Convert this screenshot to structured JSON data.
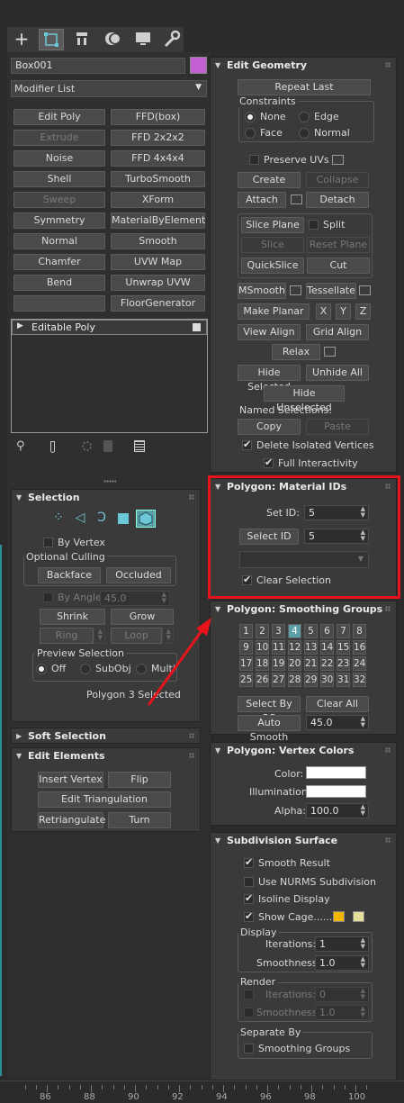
{
  "command_tabs": [
    "create-icon",
    "modify-icon",
    "hierarchy-icon",
    "motion-icon",
    "display-icon",
    "utilities-icon"
  ],
  "object": {
    "name": "Box001",
    "color": "#c35fd2"
  },
  "modifier_list": "Modifier List",
  "modifier_buttons": [
    [
      "Edit Poly",
      "FFD(box)"
    ],
    [
      "Extrude",
      "FFD 2x2x2"
    ],
    [
      "Noise",
      "FFD 4x4x4"
    ],
    [
      "Shell",
      "TurboSmooth"
    ],
    [
      "Sweep",
      "XForm"
    ],
    [
      "Symmetry",
      "MaterialByElement"
    ],
    [
      "Normal",
      "Smooth"
    ],
    [
      "Chamfer",
      "UVW Map"
    ],
    [
      "Bend",
      "Unwrap UVW"
    ],
    [
      "",
      "FloorGenerator"
    ]
  ],
  "stack": {
    "item": "Editable Poly"
  },
  "selection": {
    "title": "Selection",
    "by_vertex": "By Vertex",
    "optional_culling": "Optional Culling",
    "backface": "Backface",
    "occluded": "Occluded",
    "by_angle": "By Angle:",
    "by_angle_value": "45.0",
    "shrink": "Shrink",
    "grow": "Grow",
    "ring": "Ring",
    "loop": "Loop",
    "preview_selection": "Preview Selection",
    "off": "Off",
    "subobj": "SubObj",
    "multi": "Multi",
    "status": "Polygon 3 Selected"
  },
  "soft_selection": {
    "title": "Soft Selection"
  },
  "edit_elements": {
    "title": "Edit Elements",
    "insert_vertex": "Insert Vertex",
    "flip": "Flip",
    "edit_triangulation": "Edit Triangulation",
    "retriangulate": "Retriangulate",
    "turn": "Turn"
  },
  "edit_geometry": {
    "title": "Edit Geometry",
    "repeat_last": "Repeat Last",
    "constraints": "Constraints",
    "none": "None",
    "edge": "Edge",
    "face": "Face",
    "normal": "Normal",
    "preserve_uvs": "Preserve UVs",
    "create": "Create",
    "collapse": "Collapse",
    "attach": "Attach",
    "detach": "Detach",
    "slice_plane": "Slice Plane",
    "split": "Split",
    "slice": "Slice",
    "reset_plane": "Reset Plane",
    "quickslice": "QuickSlice",
    "cut": "Cut",
    "msmooth": "MSmooth",
    "tessellate": "Tessellate",
    "make_planar": "Make Planar",
    "x": "X",
    "y": "Y",
    "z": "Z",
    "view_align": "View Align",
    "grid_align": "Grid Align",
    "relax": "Relax",
    "hide_selected": "Hide Selected",
    "unhide_all": "Unhide All",
    "hide_unselected": "Hide Unselected",
    "named_selections": "Named Selections:",
    "copy": "Copy",
    "paste": "Paste",
    "delete_isolated": "Delete Isolated Vertices",
    "full_interactivity": "Full Interactivity"
  },
  "material_ids": {
    "title": "Polygon: Material IDs",
    "set_id": "Set ID:",
    "set_id_value": "5",
    "select_id": "Select ID",
    "select_id_value": "5",
    "clear_selection": "Clear Selection"
  },
  "smoothing_groups": {
    "title": "Polygon: Smoothing Groups",
    "groups": [
      "1",
      "2",
      "3",
      "4",
      "5",
      "6",
      "7",
      "8",
      "9",
      "10",
      "11",
      "12",
      "13",
      "14",
      "15",
      "16",
      "17",
      "18",
      "19",
      "20",
      "21",
      "22",
      "23",
      "24",
      "25",
      "26",
      "27",
      "28",
      "29",
      "30",
      "31",
      "32"
    ],
    "active": "4",
    "select_by_sg": "Select By SG",
    "clear_all": "Clear All",
    "auto_smooth": "Auto Smooth",
    "auto_smooth_value": "45.0"
  },
  "vertex_colors": {
    "title": "Polygon: Vertex Colors",
    "color": "Color:",
    "illumination": "Illumination:",
    "alpha": "Alpha:",
    "alpha_value": "100.0"
  },
  "subdivision": {
    "title": "Subdivision Surface",
    "smooth_result": "Smooth Result",
    "use_nurms": "Use NURMS Subdivision",
    "isoline": "Isoline Display",
    "show_cage": "Show Cage......",
    "cage_color1": "#f2b500",
    "cage_color2": "#e4e09a",
    "display": "Display",
    "iterations": "Iterations:",
    "iterations_value": "1",
    "smoothness": "Smoothness:",
    "smoothness_value": "1.0",
    "render": "Render",
    "r_iterations": "Iterations:",
    "r_iterations_value": "0",
    "r_smoothness": "Smoothness:",
    "r_smoothness_value": "1.0",
    "separate_by": "Separate By",
    "smoothing_groups": "Smoothing Groups"
  },
  "ruler": [
    "86",
    "88",
    "90",
    "92",
    "94",
    "96",
    "98",
    "100"
  ],
  "highlight_color": "#e8141c"
}
